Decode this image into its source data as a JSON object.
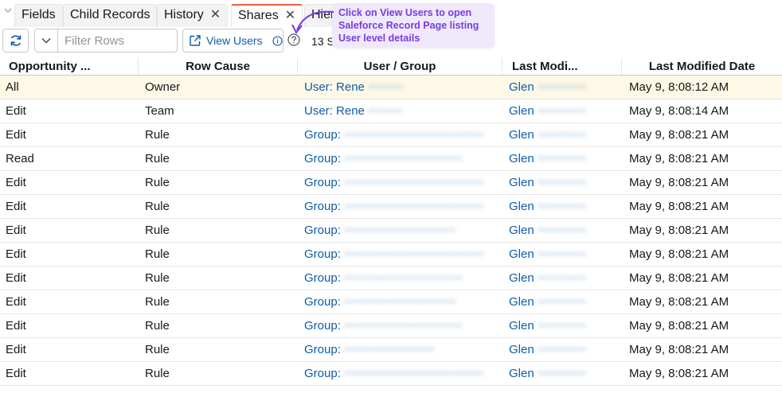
{
  "tabs": [
    {
      "label": "Fields",
      "closable": false,
      "active": false
    },
    {
      "label": "Child Records",
      "closable": false,
      "active": false
    },
    {
      "label": "History",
      "closable": true,
      "active": false
    },
    {
      "label": "Shares",
      "closable": true,
      "active": true
    },
    {
      "label": "Hier",
      "closable": false,
      "active": false
    }
  ],
  "toolbar": {
    "filter_placeholder": "Filter Rows",
    "filter_value": "",
    "view_users_label": "View Users",
    "count_text": "13 S"
  },
  "callout": {
    "text": "Click on View Users to open Saleforce Record Page listing User level details"
  },
  "columns": [
    "Opportunity ...",
    "Row Cause",
    "User / Group",
    "Last Modi...",
    "Last Modified Date"
  ],
  "rows": [
    {
      "access": "All",
      "cause": "Owner",
      "user_group": "User: Rene ~~~~~",
      "modified_by": "Glen ~~~~~~~",
      "date": "May 9, 8:08:12 AM",
      "selected": true
    },
    {
      "access": "Edit",
      "cause": "Team",
      "user_group": "User: Rene ~~~~~",
      "modified_by": "Glen ~~~~~~~",
      "date": "May 9, 8:08:14 AM",
      "selected": false
    },
    {
      "access": "Edit",
      "cause": "Rule",
      "user_group": "Group: ~~~~~~~~~~~~~~~~~~~~",
      "modified_by": "Glen ~~~~~~~",
      "date": "May 9, 8:08:21 AM",
      "selected": false
    },
    {
      "access": "Read",
      "cause": "Rule",
      "user_group": "Group: ~~~~~~~~~~~~~~~~~",
      "modified_by": "Glen ~~~~~~~",
      "date": "May 9, 8:08:21 AM",
      "selected": false
    },
    {
      "access": "Edit",
      "cause": "Rule",
      "user_group": "Group: ~~~~~~~~~~~~~~~~~~~~",
      "modified_by": "Glen ~~~~~~~",
      "date": "May 9, 8:08:21 AM",
      "selected": false
    },
    {
      "access": "Edit",
      "cause": "Rule",
      "user_group": "Group: ~~~~~~~~~~~~~~~~~~~~",
      "modified_by": "Glen ~~~~~~~",
      "date": "May 9, 8:08:21 AM",
      "selected": false
    },
    {
      "access": "Edit",
      "cause": "Rule",
      "user_group": "Group: ~~~~~~~~~~~~~~~~",
      "modified_by": "Glen ~~~~~~~",
      "date": "May 9, 8:08:21 AM",
      "selected": false
    },
    {
      "access": "Edit",
      "cause": "Rule",
      "user_group": "Group: ~~~~~~~~~~~~~~~~~~~~",
      "modified_by": "Glen ~~~~~~~",
      "date": "May 9, 8:08:21 AM",
      "selected": false
    },
    {
      "access": "Edit",
      "cause": "Rule",
      "user_group": "Group: ~~~~~~~~~~~~~~~~~",
      "modified_by": "Glen ~~~~~~~",
      "date": "May 9, 8:08:21 AM",
      "selected": false
    },
    {
      "access": "Edit",
      "cause": "Rule",
      "user_group": "Group: ~~~~~~~~~~~~~~~~",
      "modified_by": "Glen ~~~~~~~",
      "date": "May 9, 8:08:21 AM",
      "selected": false
    },
    {
      "access": "Edit",
      "cause": "Rule",
      "user_group": "Group: ~~~~~~~~~~~~~~~~~",
      "modified_by": "Glen ~~~~~~~",
      "date": "May 9, 8:08:21 AM",
      "selected": false
    },
    {
      "access": "Edit",
      "cause": "Rule",
      "user_group": "Group: ~~~~~~~~~~~~~",
      "modified_by": "Glen ~~~~~~~",
      "date": "May 9, 8:08:21 AM",
      "selected": false
    },
    {
      "access": "Edit",
      "cause": "Rule",
      "user_group": "Group: ~~~~~~~~~~~~~~~~~~~~",
      "modified_by": "Glen ~~~~~~~",
      "date": "May 9, 8:08:21 AM",
      "selected": false
    }
  ],
  "icons": {
    "refresh": "refresh-icon",
    "dropdown": "chevron-down-icon",
    "view_users": "open-external-icon",
    "info": "info-icon",
    "help": "help-icon",
    "tab_collapse": "caret-down-icon",
    "tab_close": "close-icon"
  },
  "colors": {
    "link": "#0b5cab",
    "active_tab_accent": "#e8603c",
    "selected_row": "#fef9e6",
    "callout_bg": "#efe9fb",
    "callout_text": "#7a3ce0"
  }
}
